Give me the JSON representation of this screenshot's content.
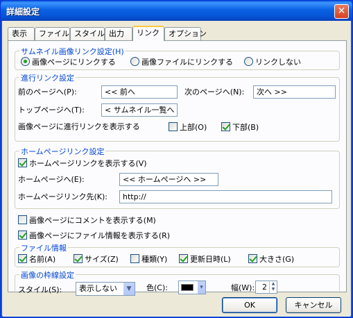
{
  "window": {
    "title": "詳細設定",
    "close_symbol": "✕"
  },
  "tabs": [
    "表示",
    "ファイル",
    "スタイル",
    "出力",
    "リンク",
    "オプション"
  ],
  "thumbnail_link": {
    "legend": "サムネイル画像リンク設定(H)",
    "options": [
      "画像ページにリンクする",
      "画像ファイルにリンクする",
      "リンクしない"
    ],
    "selected": 0
  },
  "progress_link": {
    "legend": "進行リンク設定",
    "prev_label": "前のページへ(P):",
    "prev_value": "<< 前へ",
    "next_label": "次のページへ(N):",
    "next_value": "次へ >>",
    "top_label": "トップページへ(T):",
    "top_value": "< サムネイル一覧へ >",
    "show_label": "画像ページに進行リンクを表示する",
    "top_pos_label": "上部(O)",
    "top_pos_checked": false,
    "bottom_pos_label": "下部(B)",
    "bottom_pos_checked": true
  },
  "homepage_link": {
    "legend": "ホームページリンク設定",
    "show_label": "ホームページリンクを表示する(V)",
    "show_checked": true,
    "to_label": "ホームページへ(E):",
    "to_value": "<< ホームページへ >>",
    "url_label": "ホームページリンク先(K):",
    "url_value": "http://"
  },
  "comment_checkbox": {
    "label": "画像ページにコメントを表示する(M)",
    "checked": false
  },
  "fileinfo_checkbox": {
    "label": "画像ページにファイル情報を表示する(R)",
    "checked": true
  },
  "file_info": {
    "legend": "ファイル情報",
    "items": [
      {
        "label": "名前(A)",
        "checked": true
      },
      {
        "label": "サイズ(Z)",
        "checked": true
      },
      {
        "label": "種類(Y)",
        "checked": false
      },
      {
        "label": "更新日時(L)",
        "checked": true
      },
      {
        "label": "大きさ(G)",
        "checked": true
      }
    ]
  },
  "border": {
    "legend": "画像の枠線設定",
    "style_label": "スタイル(S):",
    "style_value": "表示しない",
    "color_label": "色(C):",
    "color_value": "#000000",
    "width_label": "幅(W):",
    "width_value": "2"
  },
  "buttons": {
    "ok": "OK",
    "cancel": "キャンセル"
  },
  "colors": {
    "accent": "#0046d5",
    "titlebar": "#0a62e3",
    "check": "#21a121"
  }
}
